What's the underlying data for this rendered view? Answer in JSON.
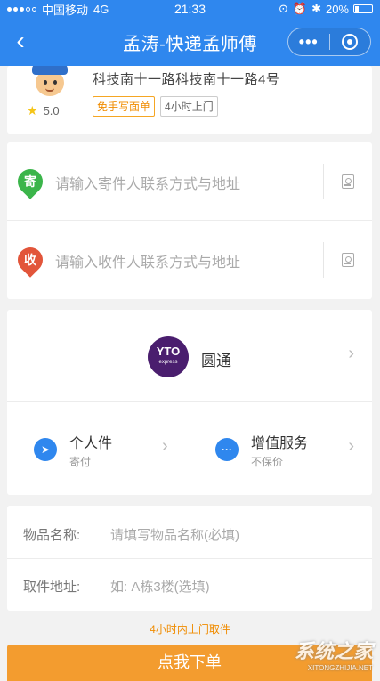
{
  "status_bar": {
    "carrier": "中国移动",
    "network": "4G",
    "time": "21:33",
    "battery": "20%"
  },
  "nav": {
    "back_icon": "chevron-left-icon",
    "title": "孟涛-快递孟师傅",
    "more_icon": "more-dots-icon",
    "close_icon": "close-circle-icon"
  },
  "courier": {
    "rating": "5.0",
    "address": "科技南十一路科技南十一路4号",
    "tags": [
      "免手写面单",
      "4小时上门"
    ]
  },
  "addresses": {
    "sender": {
      "badge": "寄",
      "placeholder": "请输入寄件人联系方式与地址"
    },
    "receiver": {
      "badge": "收",
      "placeholder": "请输入收件人联系方式与地址"
    }
  },
  "express": {
    "company": "圆通",
    "logo_text": "YTO",
    "logo_sub": "express",
    "services": [
      {
        "title": "个人件",
        "sub": "寄付",
        "icon": "send-plane-icon"
      },
      {
        "title": "增值服务",
        "sub": "不保价",
        "icon": "more-dots-icon"
      }
    ]
  },
  "goods": {
    "name_label": "物品名称:",
    "name_placeholder": "请填写物品名称(必填)",
    "pickup_label": "取件地址:",
    "pickup_placeholder": "如: A栋3楼(选填)"
  },
  "footer": {
    "hint": "4小时内上门取件",
    "submit": "点我下单"
  },
  "watermark": {
    "main": "系统之家",
    "sub": "XITONGZHIJIA.NET"
  },
  "colors": {
    "header": "#2f87ee",
    "accent_orange": "#f39c2f",
    "sender_pin": "#3bb54a",
    "receiver_pin": "#e2553a"
  }
}
